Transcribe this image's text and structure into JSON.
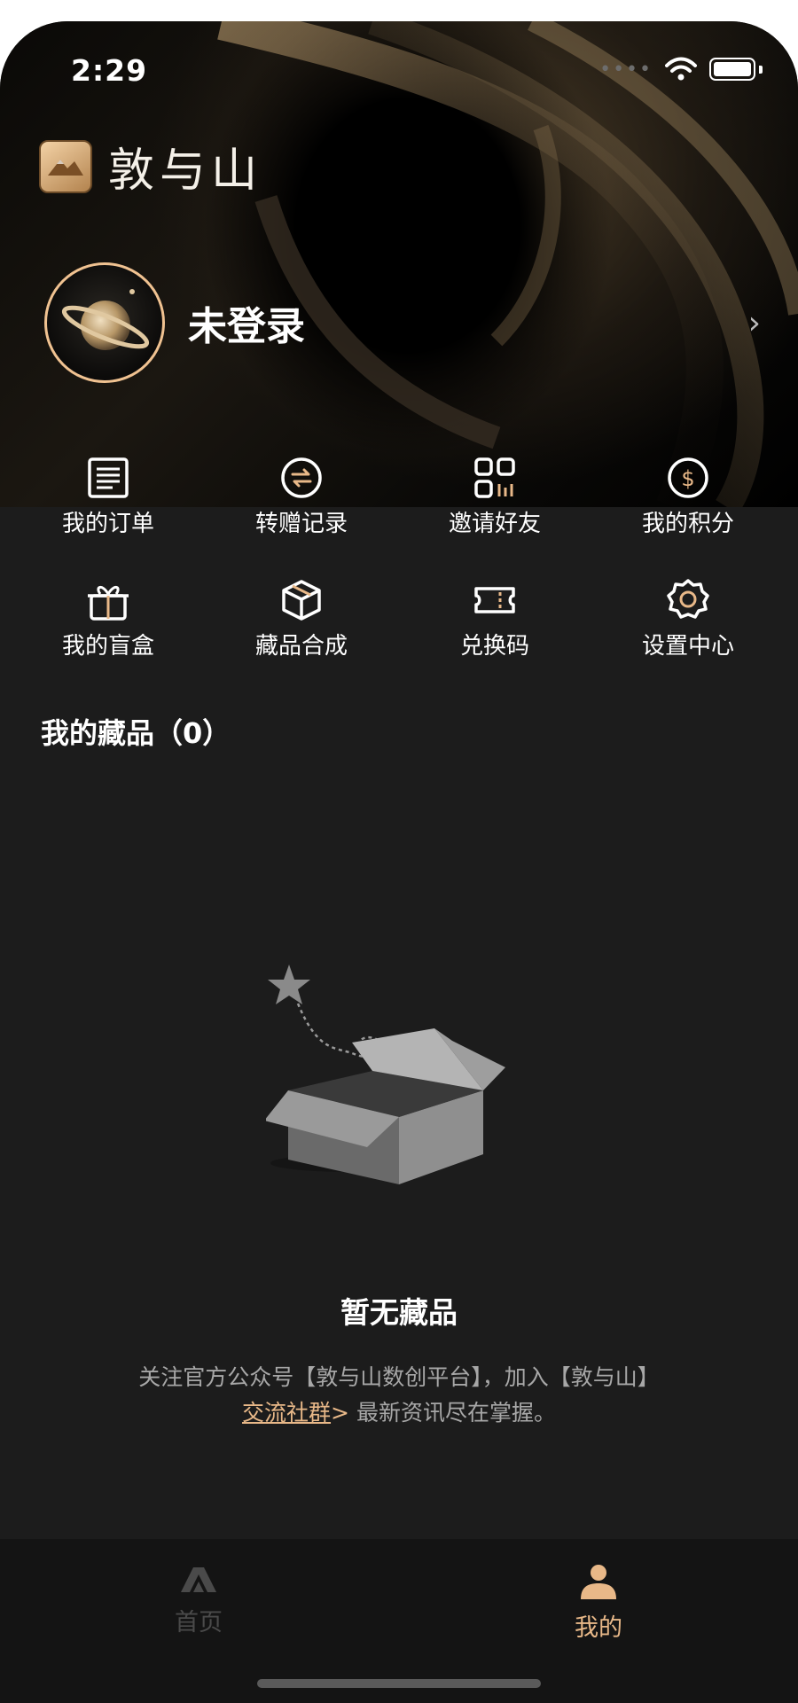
{
  "status_bar": {
    "time": "2:29"
  },
  "app": {
    "logo_text": "敦与山"
  },
  "profile": {
    "name": "未登录"
  },
  "menu": {
    "row1": [
      {
        "label": "我的订单",
        "icon": "order-list-icon"
      },
      {
        "label": "转赠记录",
        "icon": "transfer-icon"
      },
      {
        "label": "邀请好友",
        "icon": "qr-code-icon"
      },
      {
        "label": "我的积分",
        "icon": "dollar-coin-icon"
      }
    ],
    "row2": [
      {
        "label": "我的盲盒",
        "icon": "gift-icon"
      },
      {
        "label": "藏品合成",
        "icon": "cube-icon"
      },
      {
        "label": "兑换码",
        "icon": "ticket-icon"
      },
      {
        "label": "设置中心",
        "icon": "gear-icon"
      }
    ]
  },
  "collections": {
    "title": "我的藏品（0）",
    "empty_title": "暂无藏品",
    "desc_part1": "关注官方公众号【敦与山数创平台】，加入【敦与山】",
    "desc_link": "交流社群",
    "desc_arrow": ">",
    "desc_part2": " 最新资讯尽在掌握。"
  },
  "tabbar": {
    "home_label": "首页",
    "mine_label": "我的",
    "active_color": "#e8b888",
    "inactive_color": "#4a4a4a"
  },
  "colors": {
    "accent": "#e8b888",
    "background": "#1c1c1c"
  }
}
